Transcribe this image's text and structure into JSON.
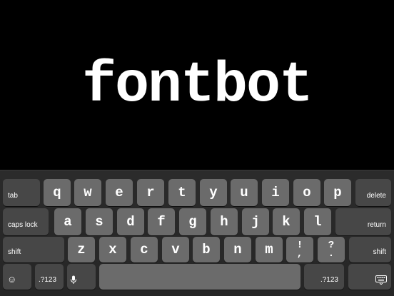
{
  "app": {
    "title": "fontbot"
  },
  "keyboard": {
    "row1": {
      "letters": [
        "q",
        "w",
        "e",
        "r",
        "t",
        "y",
        "u",
        "i",
        "o",
        "p"
      ],
      "left": "tab",
      "right": "delete"
    },
    "row2": {
      "letters": [
        "a",
        "s",
        "d",
        "f",
        "g",
        "h",
        "j",
        "k",
        "l"
      ],
      "left": "caps lock",
      "right": "return"
    },
    "row3": {
      "letters": [
        "z",
        "x",
        "c",
        "v",
        "b",
        "n",
        "m"
      ],
      "punct1": {
        "top": "!",
        "bottom": ","
      },
      "punct2": {
        "top": "?",
        "bottom": "."
      },
      "left": "shift",
      "right": "shift"
    },
    "row4": {
      "emoji_icon": "emoji-icon",
      "numbers_left": ".?123",
      "mic_icon": "microphone-icon",
      "numbers_right": ".?123",
      "hide_icon": "keyboard-hide-icon"
    }
  }
}
